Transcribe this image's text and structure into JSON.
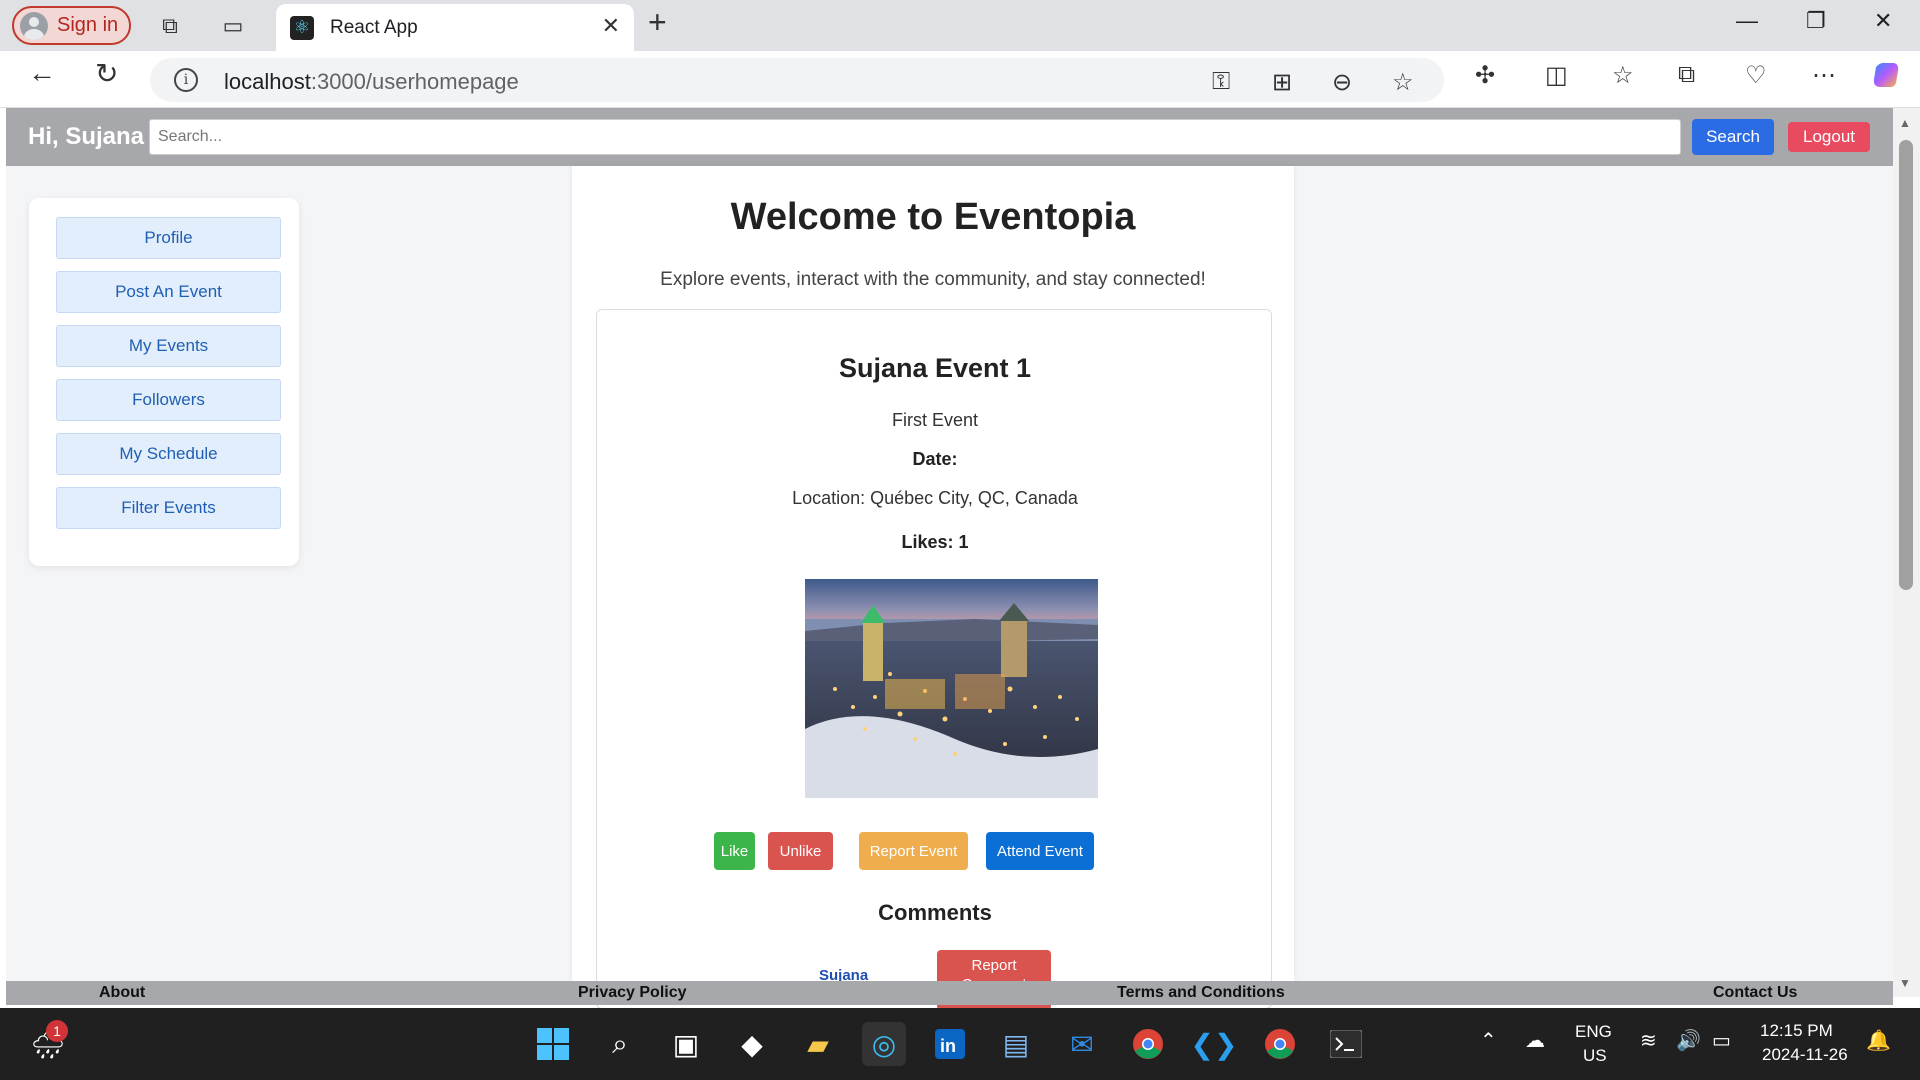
{
  "browser": {
    "signin_label": "Sign in",
    "tab_title": "React App",
    "url_host": "localhost",
    "url_path": ":3000/userhomepage"
  },
  "header": {
    "greeting": "Hi, Sujana",
    "search_placeholder": "Search...",
    "search_label": "Search",
    "logout_label": "Logout"
  },
  "sidebar": {
    "items": [
      {
        "label": "Profile"
      },
      {
        "label": "Post An Event"
      },
      {
        "label": "My Events"
      },
      {
        "label": "Followers"
      },
      {
        "label": "My Schedule"
      },
      {
        "label": "Filter Events"
      }
    ]
  },
  "main": {
    "title": "Welcome to Eventopia",
    "tagline": "Explore events, interact with the community, and stay connected!"
  },
  "event": {
    "title": "Sujana Event 1",
    "description": "First Event",
    "date_label": "Date:",
    "location": "Location: Québec City, QC, Canada",
    "likes": "Likes: 1",
    "buttons": {
      "like": "Like",
      "unlike": "Unlike",
      "report": "Report Event",
      "attend": "Attend Event"
    },
    "comments_heading": "Comments",
    "report_comment_label": "Report Comment",
    "comment_user": "Sujana"
  },
  "footer": {
    "about": "About",
    "privacy": "Privacy Policy",
    "terms": "Terms and Conditions",
    "contact": "Contact Us"
  },
  "taskbar": {
    "weather_badge": "1",
    "lang_top": "ENG",
    "lang_bottom": "US",
    "time": "12:15 PM",
    "date": "2024-11-26"
  },
  "colors": {
    "header_bg": "#a6a8ab",
    "like": "#3cb54a",
    "unlike": "#d9534f",
    "report": "#f0ad4e",
    "attend": "#0b6fd6",
    "search": "#2b6ce5",
    "logout": "#e84a5f"
  }
}
